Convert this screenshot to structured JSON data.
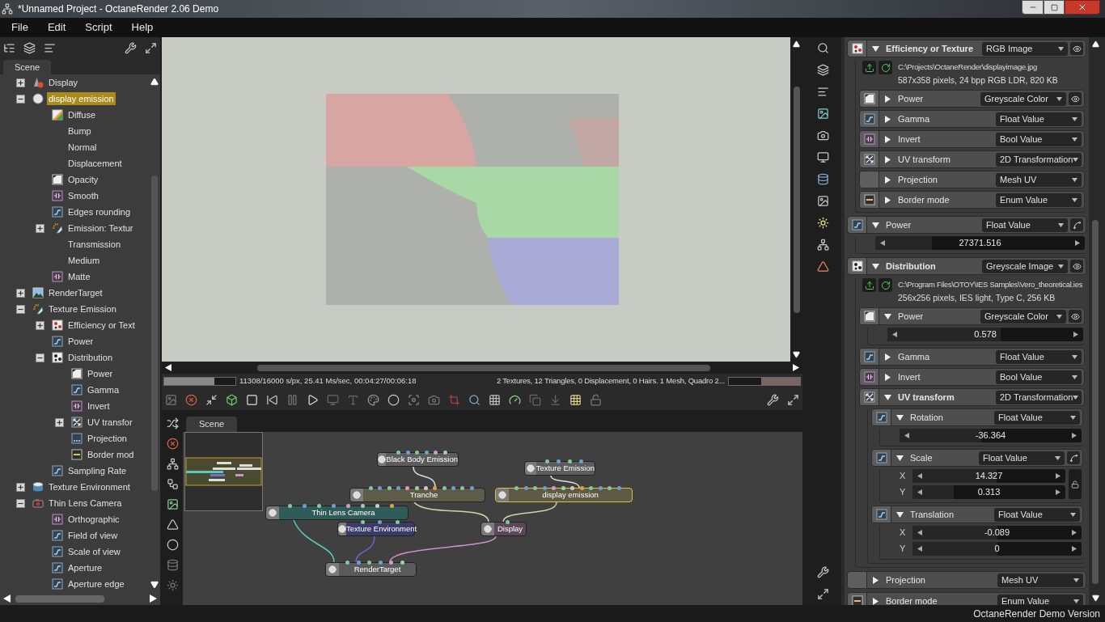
{
  "window": {
    "title": "*Unnamed Project - OctaneRender 2.06 Demo"
  },
  "menu": [
    "File",
    "Edit",
    "Script",
    "Help"
  ],
  "scene_panel": {
    "tab": "Scene",
    "tree": [
      {
        "label": "Display",
        "kind": "display",
        "expanded": false,
        "selected": false
      },
      {
        "label": "display emission",
        "kind": "material",
        "expanded": true,
        "selected": true,
        "children": [
          {
            "label": "Diffuse",
            "kind": "image",
            "selected": false
          },
          {
            "label": "Bump",
            "selected": false
          },
          {
            "label": "Normal",
            "selected": false
          },
          {
            "label": "Displacement",
            "selected": false
          },
          {
            "label": "Opacity",
            "kind": "greyscale",
            "selected": false
          },
          {
            "label": "Smooth",
            "kind": "bool",
            "selected": false
          },
          {
            "label": "Edges rounding",
            "kind": "float",
            "selected": false
          },
          {
            "label": "Emission: Textur",
            "kind": "emission",
            "expanded": false,
            "selected": false
          },
          {
            "label": "Transmission",
            "selected": false
          },
          {
            "label": "Medium",
            "selected": false
          },
          {
            "label": "Matte",
            "kind": "bool",
            "selected": false
          }
        ]
      },
      {
        "label": "RenderTarget",
        "kind": "rendertarget",
        "expanded": false,
        "selected": false
      },
      {
        "label": "Texture Emission",
        "kind": "emission",
        "expanded": true,
        "selected": false,
        "children": [
          {
            "label": "Efficiency or Text",
            "kind": "texture",
            "expanded": false,
            "selected": false
          },
          {
            "label": "Power",
            "kind": "float",
            "selected": false
          },
          {
            "label": "Distribution",
            "kind": "texture_grey",
            "expanded": true,
            "selected": false,
            "children": [
              {
                "label": "Power",
                "kind": "greyscale",
                "selected": false
              },
              {
                "label": "Gamma",
                "kind": "float",
                "selected": false
              },
              {
                "label": "Invert",
                "kind": "bool",
                "selected": false
              },
              {
                "label": "UV transfor",
                "kind": "transform",
                "expanded": false,
                "selected": false
              },
              {
                "label": "Projection",
                "kind": "projection",
                "selected": false
              },
              {
                "label": "Border mod",
                "kind": "enum",
                "selected": false
              }
            ]
          },
          {
            "label": "Sampling Rate",
            "kind": "float",
            "selected": false
          }
        ]
      },
      {
        "label": "Texture Environment",
        "kind": "environment",
        "expanded": false,
        "selected": false
      },
      {
        "label": "Thin Lens Camera",
        "kind": "camera",
        "expanded": true,
        "selected": false,
        "children": [
          {
            "label": "Orthographic",
            "kind": "bool",
            "selected": false
          },
          {
            "label": "Field of view",
            "kind": "float",
            "selected": false
          },
          {
            "label": "Scale of view",
            "kind": "float",
            "selected": false
          },
          {
            "label": "Aperture",
            "kind": "float",
            "selected": false
          },
          {
            "label": "Aperture edge",
            "kind": "float",
            "selected": false
          }
        ]
      }
    ]
  },
  "viewport": {
    "render_progress": {
      "level": 0.7
    },
    "render_stats": "11308/16000 s/px, 25.41 Ms/sec, 00:04:27/00:06:18",
    "scene_stats": "2 Textures, 12 Triangles, 0 Displacement, 0 Hairs. 1 Mesh, Quadro 2...",
    "memory": {
      "level": 0.55
    }
  },
  "node_graph": {
    "tab": "Scene",
    "nodes": [
      {
        "label": "Black Body Emission",
        "color": "#5c5c5c",
        "selected": false
      },
      {
        "label": "Texture Emission",
        "color": "#5c5c5c",
        "selected": false
      },
      {
        "label": "Tranche",
        "color": "#5e5b48",
        "selected": false
      },
      {
        "label": "display emission",
        "color": "#5e5a44",
        "selected": true
      },
      {
        "label": "Thin Lens Camera",
        "color": "#2f5b58",
        "selected": false
      },
      {
        "label": "Texture Environment",
        "color": "#3b3b68",
        "selected": false
      },
      {
        "label": "Display",
        "color": "#5b4757",
        "selected": false
      },
      {
        "label": "RenderTarget",
        "color": "#5a5a5a",
        "selected": false
      }
    ]
  },
  "inspector": {
    "pins": [
      {
        "label": "Efficiency or Texture",
        "kind": "texture",
        "expanded": true,
        "type": "RGB Image",
        "eye_button": true,
        "file": {
          "path": "C:\\Projects\\OctaneRender\\displayimage.jpg",
          "info": "587x358 pixels, 24 bpp RGB LDR, 820 KB"
        },
        "children": [
          {
            "label": "Power",
            "kind": "greyscale",
            "expanded": false,
            "type": "Greyscale Color",
            "eye_button": true
          },
          {
            "label": "Gamma",
            "kind": "float",
            "expanded": false,
            "type": "Float Value"
          },
          {
            "label": "Invert",
            "kind": "bool",
            "expanded": false,
            "type": "Bool Value"
          },
          {
            "label": "UV transform",
            "kind": "transform",
            "expanded": false,
            "type": "2D Transformation"
          },
          {
            "label": "Projection",
            "kind": "blank",
            "expanded": false,
            "type": "Mesh UV"
          },
          {
            "label": "Border mode",
            "kind": "enum",
            "expanded": false,
            "type": "Enum Value"
          }
        ]
      },
      {
        "label": "Power",
        "kind": "float",
        "expanded": true,
        "type": "Float Value",
        "curve_button": true,
        "sliders": [
          {
            "value": "27371.516",
            "level": 0.27
          }
        ]
      },
      {
        "label": "Distribution",
        "kind": "texture_grey",
        "expanded": true,
        "type": "Greyscale Image",
        "eye_button": true,
        "file": {
          "path": "C:\\Program Files\\OTOY\\IES Samples\\Vero_theoretical.ies",
          "info": "256x256 pixels, IES light, Type C, 256 KB"
        },
        "children": [
          {
            "label": "Power",
            "kind": "greyscale",
            "expanded": true,
            "type": "Greyscale Color",
            "eye_button": true,
            "sliders": [
              {
                "value": "0.578",
                "level": 0.58
              }
            ]
          },
          {
            "label": "Gamma",
            "kind": "float",
            "expanded": false,
            "type": "Float Value"
          },
          {
            "label": "Invert",
            "kind": "bool",
            "expanded": false,
            "type": "Bool Value"
          },
          {
            "label": "UV transform",
            "kind": "transform",
            "expanded": true,
            "type": "2D Transformation",
            "children": [
              {
                "label": "Rotation",
                "kind": "float",
                "expanded": true,
                "type": "Float Value",
                "sliders": [
                  {
                    "value": "-36.364",
                    "level": 0.45
                  }
                ]
              },
              {
                "label": "Scale",
                "kind": "float",
                "expanded": true,
                "type": "Float Value",
                "curve_button": true,
                "lock": true,
                "sliders": [
                  {
                    "axis": "X",
                    "value": "14.327",
                    "level": 0.55
                  },
                  {
                    "axis": "Y",
                    "value": "0.313",
                    "level": 0.27
                  }
                ]
              },
              {
                "label": "Translation",
                "kind": "float",
                "expanded": true,
                "type": "Float Value",
                "sliders": [
                  {
                    "axis": "X",
                    "value": "-0.089",
                    "level": 0.5
                  },
                  {
                    "axis": "Y",
                    "value": "0",
                    "level": 0.5
                  }
                ]
              }
            ]
          }
        ]
      },
      {
        "label": "Projection",
        "kind": "blank",
        "expanded": false,
        "type": "Mesh UV"
      },
      {
        "label": "Border mode",
        "kind": "enum",
        "expanded": false,
        "type": "Enum Value"
      }
    ]
  },
  "status_bar": "OctaneRender Demo Version"
}
